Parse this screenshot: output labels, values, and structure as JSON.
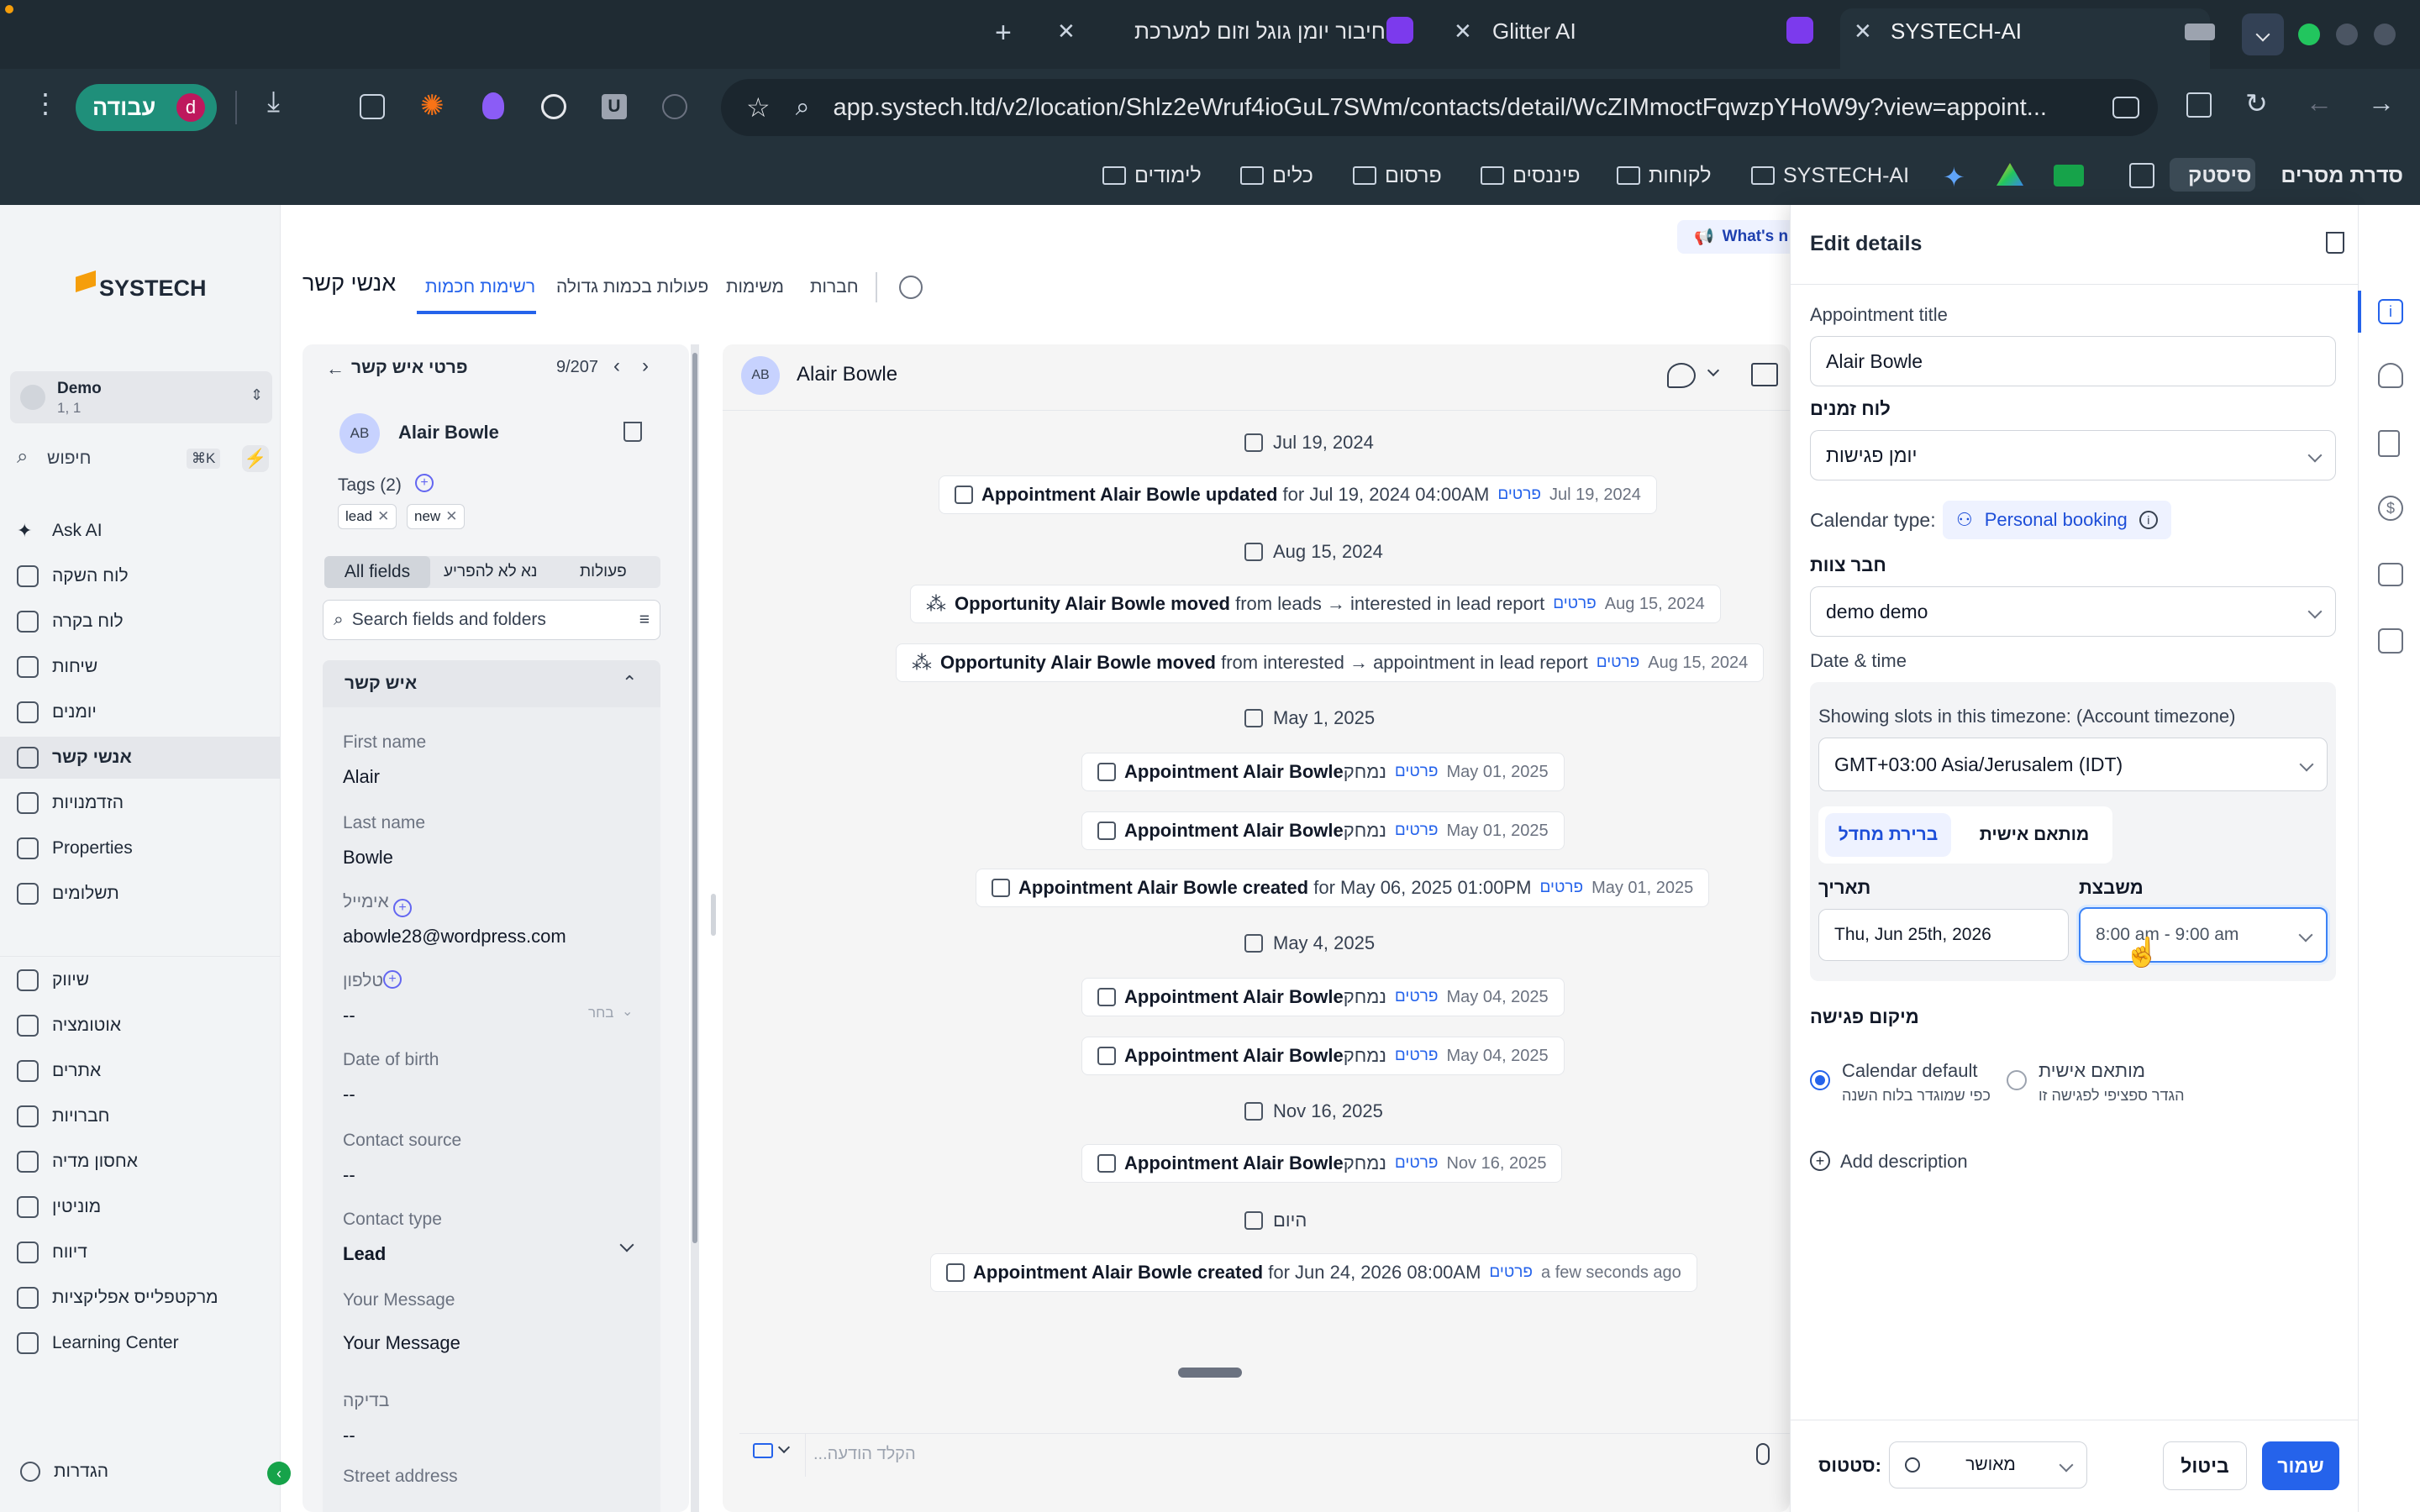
{
  "browser": {
    "tabs": [
      {
        "title": "SYSTECH-AI",
        "active": true
      },
      {
        "title": "Glitter AI",
        "active": false
      },
      {
        "title": "חיבור יומן גוגל וזום למערכת",
        "active": false
      }
    ],
    "profile": {
      "name": "עבודה",
      "initial": "d"
    },
    "url": "app.systech.ltd/v2/location/Shlz2eWruf4ioGuL7SWm/contacts/detail/WcZIMmoctFqwzpYHoW9y?view=appoint...",
    "bookmarks": [
      "סדרת מסרים",
      "סיסטק",
      "SYSTECH-AI",
      "לקוחות",
      "פיננסים",
      "פרסום",
      "כלים",
      "לימודים"
    ],
    "ext_letter": "U"
  },
  "sidebar": {
    "logo": "SYSTECH",
    "account": {
      "name": "Demo",
      "sub": "1, 1"
    },
    "search": {
      "placeholder": "חיפוש",
      "shortcut": "⌘K"
    },
    "items": [
      {
        "label": "Ask AI",
        "icon": "sparkle-icon"
      },
      {
        "label": "לוח השקה",
        "icon": "dashboard-icon"
      },
      {
        "label": "לוח בקרה",
        "icon": "grid-icon"
      },
      {
        "label": "שיחות",
        "icon": "chat-icon"
      },
      {
        "label": "יומנים",
        "icon": "calendar-icon"
      },
      {
        "label": "אנשי קשר",
        "icon": "contacts-icon",
        "active": true
      },
      {
        "label": "הזדמנויות",
        "icon": "funnel-icon"
      },
      {
        "label": "Properties",
        "icon": "building-icon"
      },
      {
        "label": "תשלומים",
        "icon": "payments-icon"
      }
    ],
    "items2": [
      {
        "label": "שיווק",
        "icon": "megaphone-icon"
      },
      {
        "label": "אוטומציה",
        "icon": "automation-icon"
      },
      {
        "label": "אתרים",
        "icon": "globe-icon"
      },
      {
        "label": "חברויות",
        "icon": "membership-icon"
      },
      {
        "label": "אחסון מדיה",
        "icon": "media-icon"
      },
      {
        "label": "מוניטין",
        "icon": "star-icon"
      },
      {
        "label": "דיווח",
        "icon": "chart-icon"
      },
      {
        "label": "מרקטפלייס אפליקציות",
        "icon": "apps-icon"
      },
      {
        "label": "Learning Center",
        "icon": "graduation-icon"
      }
    ],
    "settings": "הגדרות"
  },
  "topnav": {
    "title": "אנשי קשר",
    "tabs": [
      "רשימות חכמות",
      "פעולות בכמות גדולה",
      "משימות",
      "חברות"
    ]
  },
  "contact_panel": {
    "header": "פרטי איש קשר",
    "pager": "9/207",
    "initials": "AB",
    "name": "Alair Bowle",
    "tags_label": "Tags (2)",
    "tags": [
      "lead",
      "new"
    ],
    "filter_tabs": [
      "All fields",
      "נא לא להפריע",
      "פעולות"
    ],
    "search_placeholder": "Search fields and folders",
    "section": "איש קשר",
    "fields": [
      {
        "label": "First name",
        "value": "Alair"
      },
      {
        "label": "Last name",
        "value": "Bowle"
      },
      {
        "label": "אימייל",
        "value": "abowle28@wordpress.com"
      },
      {
        "label": "טלפון",
        "value": "--",
        "extra": "בחר"
      },
      {
        "label": "Date of birth",
        "value": "--"
      },
      {
        "label": "Contact source",
        "value": "--"
      },
      {
        "label": "Contact type",
        "value": "Lead"
      },
      {
        "label": "Your Message",
        "value": "Your Message"
      },
      {
        "label": "בדיקה",
        "value": "--"
      },
      {
        "label": "Street address",
        "value": ""
      }
    ]
  },
  "activity": {
    "initials": "AB",
    "name": "Alair Bowle",
    "whats_new": "What's n",
    "composer_placeholder": "...הקלד הודעה",
    "entries": [
      {
        "type": "date",
        "text": "Jul 19, 2024"
      },
      {
        "type": "event",
        "icon": "calendar",
        "bold": "Appointment Alair Bowle updated",
        "rest": " for Jul 19, 2024 04:00AM",
        "tag": "פרטים",
        "date": "Jul 19, 2024"
      },
      {
        "type": "date",
        "text": "Aug 15, 2024"
      },
      {
        "type": "event",
        "icon": "opportunity",
        "bold": "Opportunity Alair Bowle moved",
        "rest": " from leads → interested in lead report",
        "tag": "פרטים",
        "date": "Aug 15, 2024"
      },
      {
        "type": "event",
        "icon": "opportunity",
        "bold": "Opportunity Alair Bowle moved",
        "rest": " from interested → appointment in lead report",
        "tag": "פרטים",
        "date": "Aug 15, 2024"
      },
      {
        "type": "date",
        "text": "May 1, 2025"
      },
      {
        "type": "event",
        "icon": "calendar",
        "bold": "Appointment Alair Bowle",
        "rest": "נמחק",
        "tag": "פרטים",
        "date": "May 01, 2025"
      },
      {
        "type": "event",
        "icon": "calendar",
        "bold": "Appointment Alair Bowle",
        "rest": "נמחק",
        "tag": "פרטים",
        "date": "May 01, 2025"
      },
      {
        "type": "event",
        "icon": "calendar",
        "bold": "Appointment Alair Bowle created",
        "rest": " for May 06, 2025 01:00PM",
        "tag": "פרטים",
        "date": "May 01, 2025"
      },
      {
        "type": "date",
        "text": "May 4, 2025"
      },
      {
        "type": "event",
        "icon": "calendar",
        "bold": "Appointment Alair Bowle",
        "rest": "נמחק",
        "tag": "פרטים",
        "date": "May 04, 2025"
      },
      {
        "type": "event",
        "icon": "calendar",
        "bold": "Appointment Alair Bowle",
        "rest": "נמחק",
        "tag": "פרטים",
        "date": "May 04, 2025"
      },
      {
        "type": "date",
        "text": "Nov 16, 2025"
      },
      {
        "type": "event",
        "icon": "calendar",
        "bold": "Appointment Alair Bowle",
        "rest": "נמחק",
        "tag": "פרטים",
        "date": "Nov 16, 2025"
      },
      {
        "type": "date",
        "text": "היום"
      },
      {
        "type": "event",
        "icon": "calendar",
        "bold": "Appointment Alair Bowle created",
        "rest": " for Jun 24, 2026 08:00AM",
        "tag": "פרטים",
        "date": "a few seconds ago"
      }
    ]
  },
  "drawer": {
    "title": "Edit details",
    "appointment_title_label": "Appointment title",
    "appointment_title_value": "Alair Bowle",
    "calendar_label": "לוח זמנים",
    "calendar_value": "יומן פגישות",
    "calendar_type_label": "Calendar type:",
    "calendar_type_value": "Personal booking",
    "team_member_label": "חבר צוות",
    "team_member_value": "demo demo",
    "datetime_label": "Date & time",
    "tz_note": "Showing slots in this timezone: (Account timezone)",
    "tz_value": "GMT+03:00 Asia/Jerusalem (IDT)",
    "mode_default": "ברירת מחדל",
    "mode_custom": "מותאם אישית",
    "date_label": "תאריך",
    "date_value": "Thu, Jun 25th, 2026",
    "slot_label": "משבצת",
    "slot_value": "8:00 am - 9:00 am",
    "location_label": "מיקום פגישה",
    "loc_default_title": "Calendar default",
    "loc_default_sub": "כפי שמוגדר בלוח השנה",
    "loc_custom_title": "מותאם אישית",
    "loc_custom_sub": "הגדר ספציפי לפגישה זו",
    "add_description": "Add description",
    "status_label": "סטטוס:",
    "status_value": "מאושר",
    "cancel": "ביטול",
    "save": "שמור"
  },
  "colors": {
    "accent": "#2563eb",
    "chrome": "#24323b",
    "profile": "#1f8f7a"
  }
}
